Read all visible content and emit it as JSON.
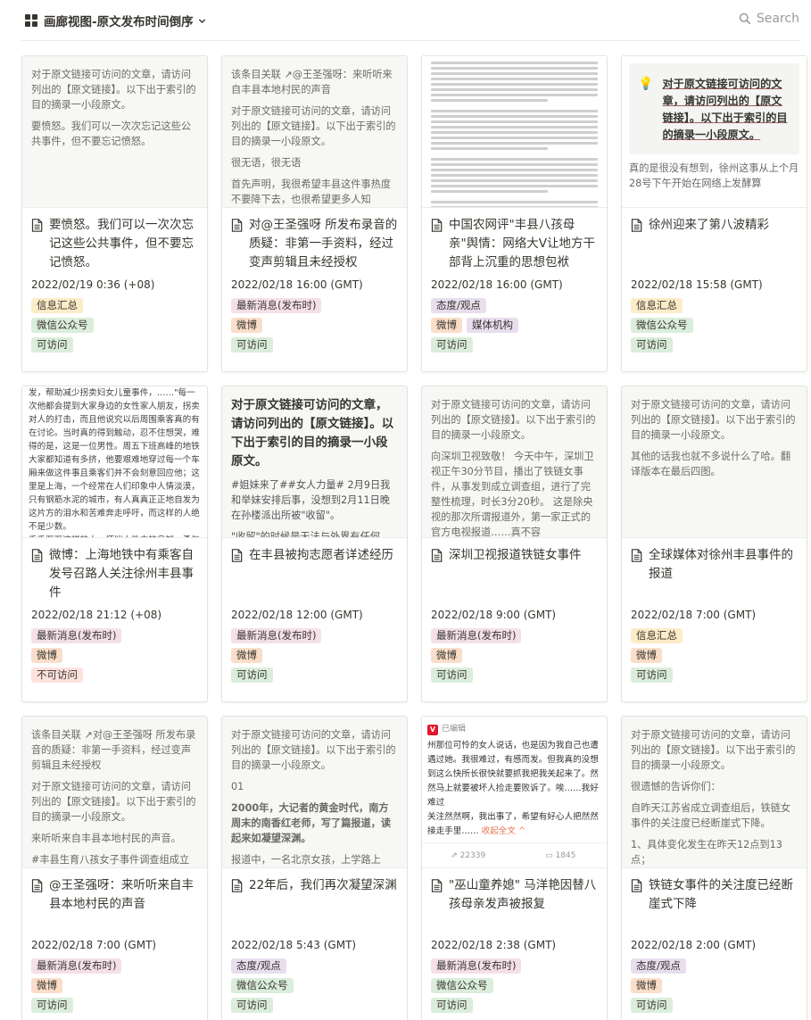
{
  "header": {
    "view_title": "画廊视图-原文发布时间倒序",
    "search_label": "Search"
  },
  "tag_colors": {
    "信息汇总": "#fdecc8",
    "微信公众号": "#dbeddb",
    "可访问": "#dbeddb",
    "最新消息(发布时)": "#f5e0e9",
    "微博": "#fadec9",
    "态度/观点": "#e8deee",
    "媒体机构": "#e8deee",
    "不可访问": "#ffe2dd"
  },
  "cards": [
    {
      "cover_type": "text",
      "cover": [
        "对于原文链接可访问的文章，请访问列出的【原文链接】。以下出于索引的目的摘录一小段原文。",
        "要愤怒。我们可以一次次忘记这些公共事件，但不要忘记愤怒。"
      ],
      "title": "要愤怒。我们可以一次次忘记这些公共事件，但不要忘记愤怒。",
      "date": "2022/02/19 0:36 (+08)",
      "tags": [
        [
          "信息汇总"
        ],
        [
          "微信公众号"
        ],
        [
          "可访问"
        ]
      ]
    },
    {
      "cover_type": "text",
      "cover": [
        "该条目关联 ↗@王圣强呀：来听听来自丰县本地村民的声音",
        "对于原文链接可访问的文章，请访问列出的【原文链接】。以下出于索引的目的摘录一小段原文。",
        "很无语，很无语",
        "首先声明，我很希望丰县这件事热度不要降下去，也很希望更多人知"
      ],
      "title": "对@王圣强呀 所发布录音的质疑：非第一手资料，经过变声剪辑且未经授权",
      "date": "2022/02/18 16:00 (GMT)",
      "tags": [
        [
          "最新消息(发布时)"
        ],
        [
          "微博"
        ],
        [
          "可访问"
        ]
      ]
    },
    {
      "cover_type": "doc",
      "cover": [],
      "title": "中国农网评\"丰县八孩母亲\"舆情：网络大V让地方干部背上沉重的思想包袱",
      "date": "2022/02/18 16:00 (GMT)",
      "tags": [
        [
          "态度/观点"
        ],
        [
          "微博",
          "媒体机构"
        ],
        [
          "可访问"
        ]
      ]
    },
    {
      "cover_type": "callout",
      "cover": [
        "对于原文链接可访问的文章，请访问列出的【原文链接】。以下出于索引的目的摘录一小段原文。",
        "真的是很没有想到，徐州这事从上个月28号下午开始在网络上发酵算"
      ],
      "title": "徐州迎来了第八波精彩",
      "date": "2022/02/18 15:58 (GMT)",
      "tags": [
        [
          "信息汇总"
        ],
        [
          "微信公众号"
        ],
        [
          "可访问"
        ]
      ]
    },
    {
      "cover_type": "doctext",
      "cover": [
        "发，帮助减少拐卖妇女儿童事件，……\"每一次他都会提到大家身边的女性家人朋友，拐卖对人的打击，而且他说究以后周围乘客真的有在讨论。当时真的得到触动，忍不住想哭，难得的是，这是一位男性。周五下班高峰的地铁大家都知道有多挤，他要艰难地穿过每一个车厢来做这件事且乘客们并不会刻意回应他；这里是上海，一个经常在人们印象中人情淡漠，只有钢筋水泥的城市，有人真真正正地自发为这片方的泪水和苦难奔走呼吁，而这样的人绝不是少数。",
        "千千万万这样的人，怀揣人性中的良知、勇气与坚持，成为引领社会不断向前的炬火，人类血脉依靠这样的美德与光荣，赓延不绝，生生不息。"
      ],
      "title": "微博：上海地铁中有乘客自发号召路人关注徐州丰县事件",
      "date": "2022/02/18 21:12 (+08)",
      "tags": [
        [
          "最新消息(发布时)"
        ],
        [
          "微博"
        ],
        [
          "不可访问"
        ]
      ]
    },
    {
      "cover_type": "bold",
      "cover": [
        "对于原文链接可访问的文章，请访问列出的【原文链接】。以下出于索引的目的摘录一小段原文。",
        "#姐妹来了##女人力量# 2月9日我和举妹安排后事，没想到2月11日晚在孙楼派出所被\"收留\"。",
        "\"收留\"的时候是无法与外界有任何"
      ],
      "title": "在丰县被拘志愿者详述经历",
      "date": "2022/02/18 12:00 (GMT)",
      "tags": [
        [
          "最新消息(发布时)"
        ],
        [
          "微博"
        ],
        [
          "可访问"
        ]
      ]
    },
    {
      "cover_type": "text",
      "cover": [
        "对于原文链接可访问的文章，请访问列出的【原文链接】。以下出于索引的目的摘录一小段原文。",
        "向深圳卫视致敬！ 今天中午，深圳卫视正午30分节目，播出了铁链女事件，从事发到成立调查组，进行了完整性梳理，时长3分20秒。 这是除央视的那次所谓报道外，第一家正式的官方电视报道……真不容"
      ],
      "title": "深圳卫视报道铁链女事件",
      "date": "2022/02/18 9:00 (GMT)",
      "tags": [
        [
          "最新消息(发布时)"
        ],
        [
          "微博"
        ],
        [
          "可访问"
        ]
      ]
    },
    {
      "cover_type": "text",
      "cover": [
        "对于原文链接可访问的文章，请访问列出的【原文链接】。以下出于索引的目的摘录一小段原文。",
        "其他的话我也就不多说什么了哈。翻译版本在最后四图。"
      ],
      "title": "全球媒体对徐州丰县事件的报道",
      "date": "2022/02/18 7:00 (GMT)",
      "tags": [
        [
          "信息汇总"
        ],
        [
          "微博"
        ],
        [
          "可访问"
        ]
      ]
    },
    {
      "cover_type": "text",
      "cover": [
        "该条目关联 ↗对@王圣强呀 所发布录音的质疑：非第一手资料，经过变声剪辑且未经授权",
        "对于原文链接可访问的文章，请访问列出的【原文链接】。以下出于索引的目的摘录一小段原文。",
        "来听听来自丰县本地村民的声音。",
        "#丰县生育八孩女子事件调查组成立"
      ],
      "title": "@王圣强呀：来听听来自丰县本地村民的声音",
      "date": "2022/02/18 7:00 (GMT)",
      "tags": [
        [
          "最新消息(发布时)"
        ],
        [
          "微博"
        ],
        [
          "可访问"
        ]
      ]
    },
    {
      "cover_type": "text2",
      "cover": [
        "对于原文链接可访问的文章，请访问列出的【原文链接】。以下出于索引的目的摘录一小段原文。",
        "01",
        "2000年，大记者的黄金时代，南方周末的南香红老师，写了篇报道，读起来如凝望深渊。",
        "报道中，一名北京女孩，上学路上"
      ],
      "title": "22年后，我们再次凝望深渊",
      "date": "2022/02/18 5:43 (GMT)",
      "tags": [
        [
          "态度/观点"
        ],
        [
          "微信公众号"
        ],
        [
          "可访问"
        ]
      ]
    },
    {
      "cover_type": "weibo",
      "cover": [
        "已编辑",
        "州那位可怜的女人说话，也是因为我自己也遭遇过她。我很难过，有感而发。但我真的没想到这么快所长很快就要抓我把我关起来了。然然马上就要被坏人捡走要败诉了。唉……我好难过",
        "关注然然啊，我出事了，希望有好心人把然然接走手里……",
        "收起全文 ^",
        "22339",
        "1845"
      ],
      "title": "\"巫山童养媳\" 马洋艳因替八孩母亲发声被报复",
      "date": "2022/02/18 2:38 (GMT)",
      "tags": [
        [
          "最新消息(发布时)"
        ],
        [
          "微信公众号"
        ],
        [
          "可访问"
        ]
      ]
    },
    {
      "cover_type": "text",
      "cover": [
        "对于原文链接可访问的文章，请访问列出的【原文链接】。以下出于索引的目的摘录一小段原文。",
        "很遗憾的告诉你们：",
        "自昨天江苏省成立调查组后，铁链女事件的关注度已经断崖式下降。",
        "1、具体变化发生在昨天12点到13点；"
      ],
      "title": "铁链女事件的关注度已经断崖式下降",
      "date": "2022/02/18 2:00 (GMT)",
      "tags": [
        [
          "态度/观点"
        ],
        [
          "微博"
        ],
        [
          "可访问"
        ]
      ]
    }
  ]
}
